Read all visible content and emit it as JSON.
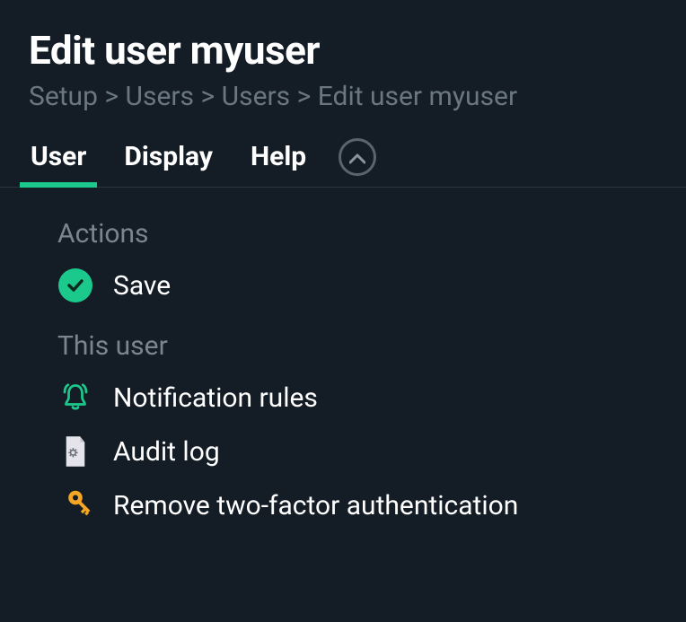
{
  "header": {
    "title": "Edit user myuser"
  },
  "breadcrumb": {
    "items": [
      "Setup",
      "Users",
      "Users",
      "Edit user myuser"
    ],
    "sep": ">"
  },
  "tabs": {
    "items": [
      {
        "label": "User",
        "active": true
      },
      {
        "label": "Display",
        "active": false
      },
      {
        "label": "Help",
        "active": false
      }
    ]
  },
  "sections": {
    "actions": {
      "label": "Actions",
      "save": "Save"
    },
    "this_user": {
      "label": "This user",
      "notification": "Notification rules",
      "audit": "Audit log",
      "remove2fa": "Remove two-factor authentication"
    }
  },
  "colors": {
    "accent": "#1cc98c",
    "key": "#f5a623",
    "muted": "#7a8590",
    "bg": "#141d26"
  }
}
